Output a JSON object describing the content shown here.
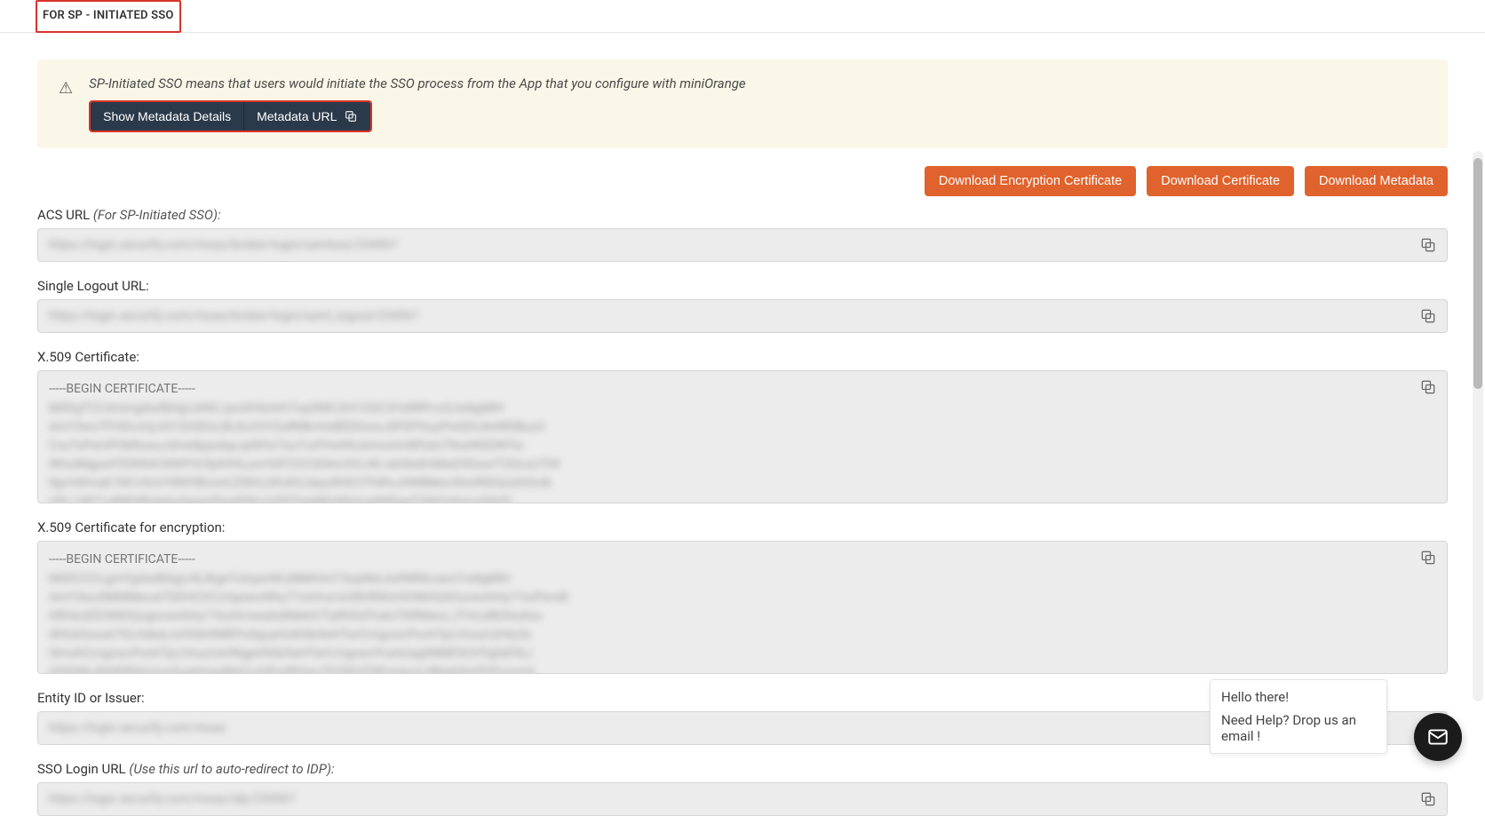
{
  "tab": {
    "label": "FOR SP - INITIATED SSO"
  },
  "banner": {
    "text": "SP-Initiated SSO means that users would initiate the SSO process from the App that you configure with miniOrange",
    "show_details": "Show Metadata Details",
    "metadata_url": "Metadata URL"
  },
  "buttons": {
    "download_encryption_cert": "Download Encryption Certificate",
    "download_cert": "Download Certificate",
    "download_metadata": "Download Metadata"
  },
  "fields": {
    "acs": {
      "label": "ACS URL",
      "note": "(For SP-Initiated SSO):"
    },
    "slo": {
      "label": "Single Logout URL:"
    },
    "cert": {
      "label": "X.509 Certificate:",
      "header": "-----BEGIN CERTIFICATE-----"
    },
    "cert_enc": {
      "label": "X.509 Certificate for encryption:",
      "header": "-----BEGIN CERTIFICATE-----"
    },
    "entity": {
      "label": "Entity ID or Issuer:"
    },
    "login": {
      "label": "SSO Login URL",
      "note": "(Use this url to auto-redirect to IDP):"
    }
  },
  "chat": {
    "greeting": "Hello there!",
    "help": "Need Help? Drop us an email !"
  },
  "placeholders": {
    "url1": "https://login.xecurify.com/moas/broker/login/samlsso/234567",
    "url2": "https://login.xecurify.com/moas/broker/login/saml_logout/234567",
    "url3": "https://login.xecurify.com/moas",
    "url4": "https://login.xecurify.com/moas/idp/234567",
    "certbody1": "MIIDgTCCAmmgAwIBAgIJANCJyniXHlsHrh7opSNfLDH1OQC3YsRRPco5Jw8gMlH\nAmY3woTFHDcoUjJOI1DiQDoLBLEo2OYZaRMkvHsBEESsoxJDFEPGuyPxiQDL8nWElBuuV\nCxuTxPemPOkRowuJdnw8pjodapJpWHcTss7cxFHohNJemosImWFptsTNuHKEDNTor\nWhuIMgyxATEIKNACKMY9c9pIHHLuorrSiFCOCQGkw3VLnKi.wkXedmMwEXDoorT2QcuLFS#\n8gvVdHvaE1M7z9zVY8NYBlvsnCZSKILGKzKILQeyzRIXCtTh8fxJHN8MecOhniRIDQolzhGnik\nUDL13871afMH8futelyolspynIDeaDSHJcDXTmeMUr86mueNtEgwCtXK2ohnvuSdsSi\nC82MxigsySBPlwgyiLymayJHHqy2qq96lElP8u43ho14C9YHHRhy3ubabpTR89qqVs",
    "certbody2": "MIIDCCCLgmYgAwIBAgIJ4LlKgeTcloyerWLMlMtVmT3opNelJrefNR8coect1w8gMlH\nAmY3woSMMMecal7DEHCOCoVgreevWhy71tzHrorrsURHRWsHIONHQAGsownhHy71toPeroB\nttRHezEDONIDQogsownhHy71kzHrrweahdtMehCTiyRIXtdTsdoTltIRMecLJTHcuREAtuttox\ndHUeGxwat70LHakaLIzHGbHIMEPoSguyHckhtbrlieHTarCrrigzwcPonhTpLtVourLkHty3x\nSImxhCrrigzwcPonhTpLtVourLkHNgpHhtbrlieHTarCrrigzwcPoxhriagSNME9CHTg0dIYkJ\nr03GN6JbhtERhhtviuoSugHmedbkCLyHPurRIVax79Y5EHTNFwreucLtRbeb9nrPOFourrck\nvSkw3QdbHLnoxrY2vPIgpKMuctokkkFhymigxVAng7@radHk6triLnrhS7YCnxrSaw"
  }
}
